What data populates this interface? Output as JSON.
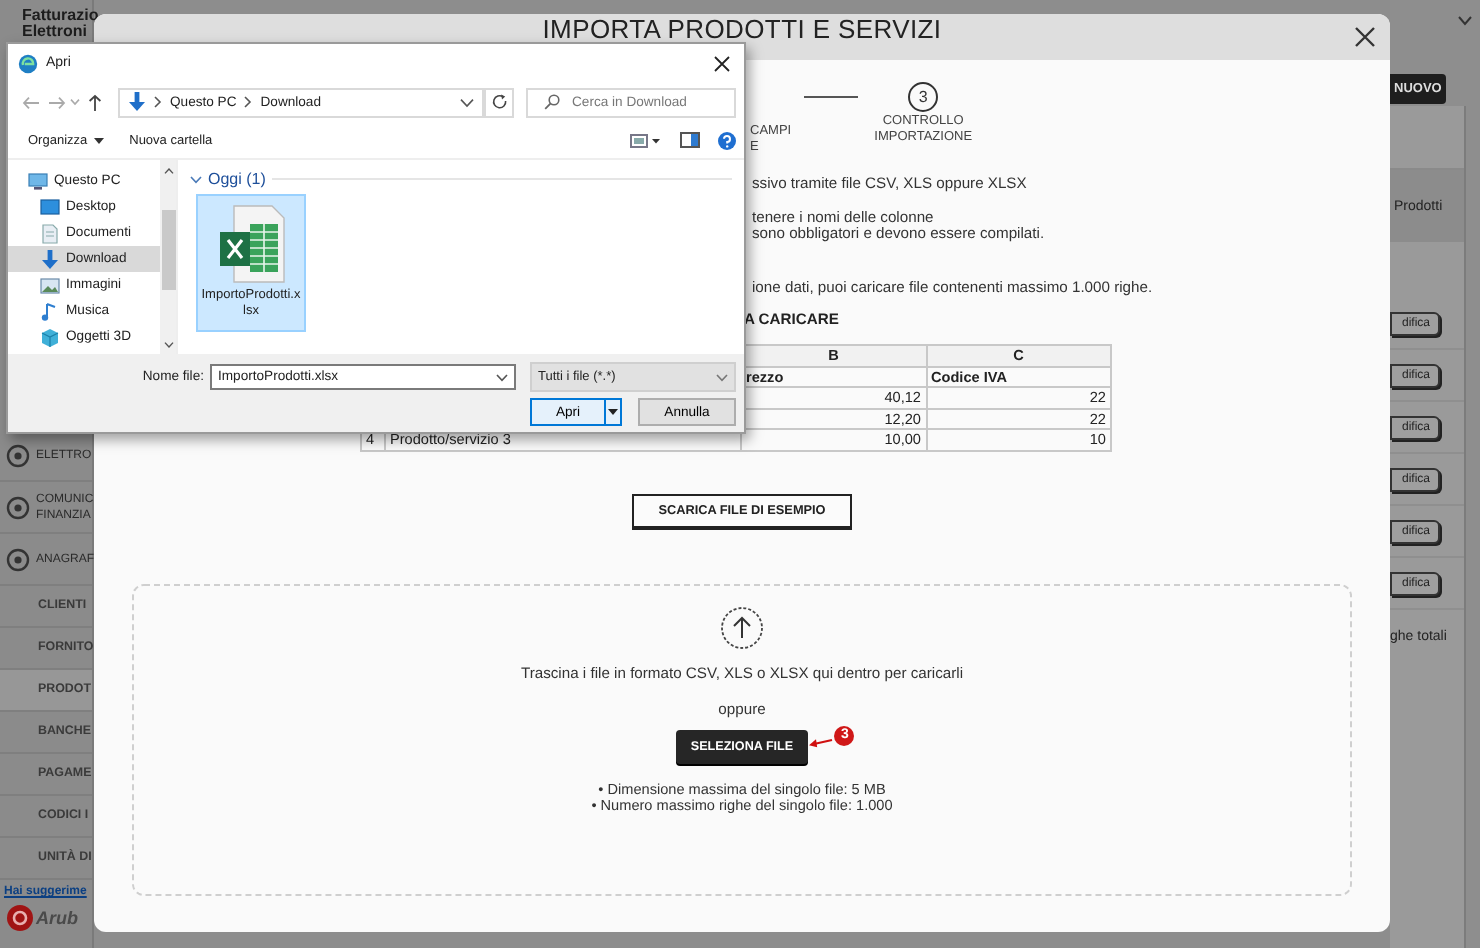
{
  "app": {
    "brand_lines": [
      "Fatturazio",
      "Elettroni"
    ],
    "sidebar": [
      {
        "kind": "section",
        "lines": [
          "ELETTRO"
        ],
        "selected": false
      },
      {
        "kind": "section",
        "lines": [
          "COMUNIC",
          "FINANZIA"
        ],
        "selected": false
      },
      {
        "kind": "section",
        "lines": [
          "ANAGRAF"
        ],
        "selected": false
      },
      {
        "kind": "sub",
        "lines": [
          "CLIENTI"
        ],
        "selected": false
      },
      {
        "kind": "sub",
        "lines": [
          "FORNITO"
        ],
        "selected": false
      },
      {
        "kind": "sub",
        "lines": [
          "PRODOT"
        ],
        "selected": true
      },
      {
        "kind": "sub",
        "lines": [
          "BANCHE"
        ],
        "selected": false
      },
      {
        "kind": "sub",
        "lines": [
          "PAGAME"
        ],
        "selected": false
      },
      {
        "kind": "sub",
        "lines": [
          "CODICI I"
        ],
        "selected": false
      },
      {
        "kind": "sub",
        "lines": [
          "UNITÀ DI"
        ],
        "selected": false
      }
    ],
    "feedback_link": "Hai suggerime",
    "logo_text": "Arub",
    "new_button": "NUOVO",
    "filter_label": "Prodotti",
    "edit_buttons": [
      "difica",
      "difica",
      "difica",
      "difica",
      "difica",
      "difica"
    ],
    "rows_total": "ghe totali"
  },
  "modal": {
    "title": "IMPORTA PRODOTTI E SERVIZI",
    "steps": [
      {
        "label_lines": [
          "CAMPI",
          "E"
        ]
      },
      {
        "number": "3",
        "label_lines": [
          "CONTROLLO",
          "IMPORTAZIONE"
        ]
      }
    ],
    "intro": [
      [
        "ssivo tramite file CSV, XLS oppure XLSX"
      ],
      [
        "tenere i nomi delle colonne",
        "sono obbligatori e devono essere compilati."
      ],
      [
        "ione dati, puoi caricare file contenenti massimo 1.000 righe."
      ]
    ],
    "example_heading": "A CARICARE",
    "table": {
      "columns": [
        "B",
        "C"
      ],
      "rows": [
        {
          "kind": "heading",
          "b": "rezzo",
          "c": "Codice IVA"
        },
        {
          "kind": "data",
          "b": "40,12",
          "c": "22"
        },
        {
          "kind": "data",
          "b": "12,20",
          "c": "22"
        },
        {
          "kind": "data",
          "row": "4",
          "a": "Prodotto/servizio 3",
          "b": "10,00",
          "c": "10"
        }
      ]
    },
    "download_button": "SCARICA FILE DI ESEMPIO",
    "dropzone": {
      "text": "Trascina i file in formato CSV, XLS o XLSX qui dentro per caricarli",
      "or_text": "oppure",
      "select_button": "SELEZIONA FILE",
      "callout": "3",
      "limits": [
        "• Dimensione massima del singolo file: 5 MB",
        "• Numero massimo righe del singolo file: 1.000"
      ]
    }
  },
  "file_dialog": {
    "title": "Apri",
    "path": [
      "Questo PC",
      "Download"
    ],
    "search": {
      "placeholder": "Cerca in Download"
    },
    "toolbar": {
      "organize": "Organizza",
      "new_folder": "Nuova cartella"
    },
    "nav": [
      {
        "label": "Questo PC",
        "kind": "pc",
        "selected": false
      },
      {
        "label": "Desktop",
        "kind": "desktop",
        "selected": false
      },
      {
        "label": "Documenti",
        "kind": "docs",
        "selected": false
      },
      {
        "label": "Download",
        "kind": "download",
        "selected": true
      },
      {
        "label": "Immagini",
        "kind": "images",
        "selected": false
      },
      {
        "label": "Musica",
        "kind": "music",
        "selected": false
      },
      {
        "label": "Oggetti 3D",
        "kind": "cube",
        "selected": false
      }
    ],
    "group": "Oggi (1)",
    "files": [
      {
        "name": "ImportoProdotti.xlsx",
        "selected": true
      }
    ],
    "filename_label": "Nome file:",
    "filename": "ImportoProdotti.xlsx",
    "filter": "Tutti i file (*.*)",
    "open_button": "Apri",
    "cancel_button": "Annulla"
  }
}
